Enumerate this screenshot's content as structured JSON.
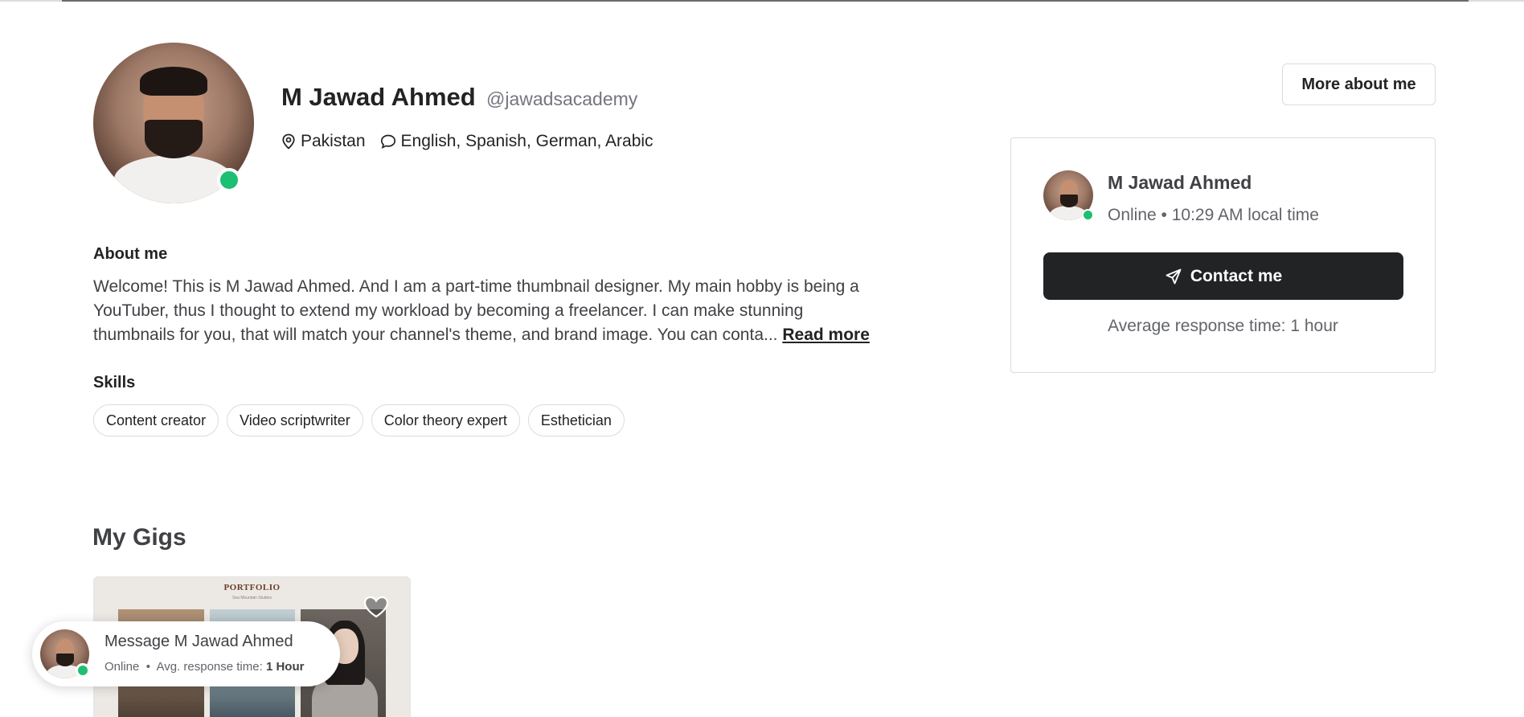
{
  "profile": {
    "name": "M Jawad Ahmed",
    "handle": "@jawadsacademy",
    "location": "Pakistan",
    "languages": "English, Spanish, German, Arabic",
    "more_button": "More about me"
  },
  "about": {
    "title": "About me",
    "text": "Welcome! This is M Jawad Ahmed. And I am a part-time thumbnail designer. My main hobby is being a YouTuber, thus I thought to extend my workload by becoming a freelancer. I can make stunning thumbnails for you, that will match your channel's theme, and brand image. You can conta...",
    "read_more": "Read more"
  },
  "skills": {
    "title": "Skills",
    "items": [
      "Content creator",
      "Video scriptwriter",
      "Color theory expert",
      "Esthetician"
    ]
  },
  "contact_card": {
    "name": "M Jawad Ahmed",
    "status": "Online • 10:29 AM local time",
    "button": "Contact me",
    "response": "Average response time: 1 hour"
  },
  "gigs": {
    "title": "My Gigs",
    "card_title": "PORTFOLIO",
    "card_sub": "Sea Mountain Studios"
  },
  "message_bubble": {
    "title": "Message M Jawad Ahmed",
    "status": "Online",
    "separator": "•",
    "response_label": "Avg. response time:",
    "response_value": "1 Hour"
  },
  "colors": {
    "online": "#1dbf73",
    "primary_button": "#222325",
    "text": "#222325",
    "muted": "#74767e"
  },
  "icons": {
    "location": "map-pin-icon",
    "languages": "chat-bubble-icon",
    "contact": "paper-plane-icon",
    "favorite": "heart-icon"
  }
}
